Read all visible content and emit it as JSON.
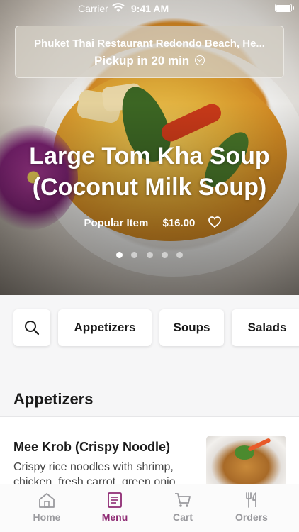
{
  "status_bar": {
    "carrier": "Carrier",
    "time": "9:41 AM"
  },
  "pickup": {
    "restaurant": "Phuket Thai Restaurant Redondo Beach, He...",
    "time_text": "Pickup in 20 min"
  },
  "hero": {
    "title_line1": "Large Tom Kha Soup",
    "title_line2": "(Coconut Milk Soup)",
    "badge": "Popular Item",
    "price": "$16.00",
    "slide_count": 5,
    "active_slide": 1
  },
  "categories": [
    "Appetizers",
    "Soups",
    "Salads"
  ],
  "section": {
    "title": "Appetizers"
  },
  "items": [
    {
      "name": "Mee Krob (Crispy Noodle)",
      "description": "Crispy rice noodles with shrimp, chicken, fresh carrot, green onio..."
    }
  ],
  "tabs": [
    {
      "label": "Home",
      "icon": "home-icon"
    },
    {
      "label": "Menu",
      "icon": "menu-icon",
      "active": true
    },
    {
      "label": "Cart",
      "icon": "cart-icon"
    },
    {
      "label": "Orders",
      "icon": "utensils-icon"
    }
  ],
  "colors": {
    "accent": "#8e2a73",
    "inactive": "#9a9a9e",
    "background": "#f6f6f7"
  }
}
